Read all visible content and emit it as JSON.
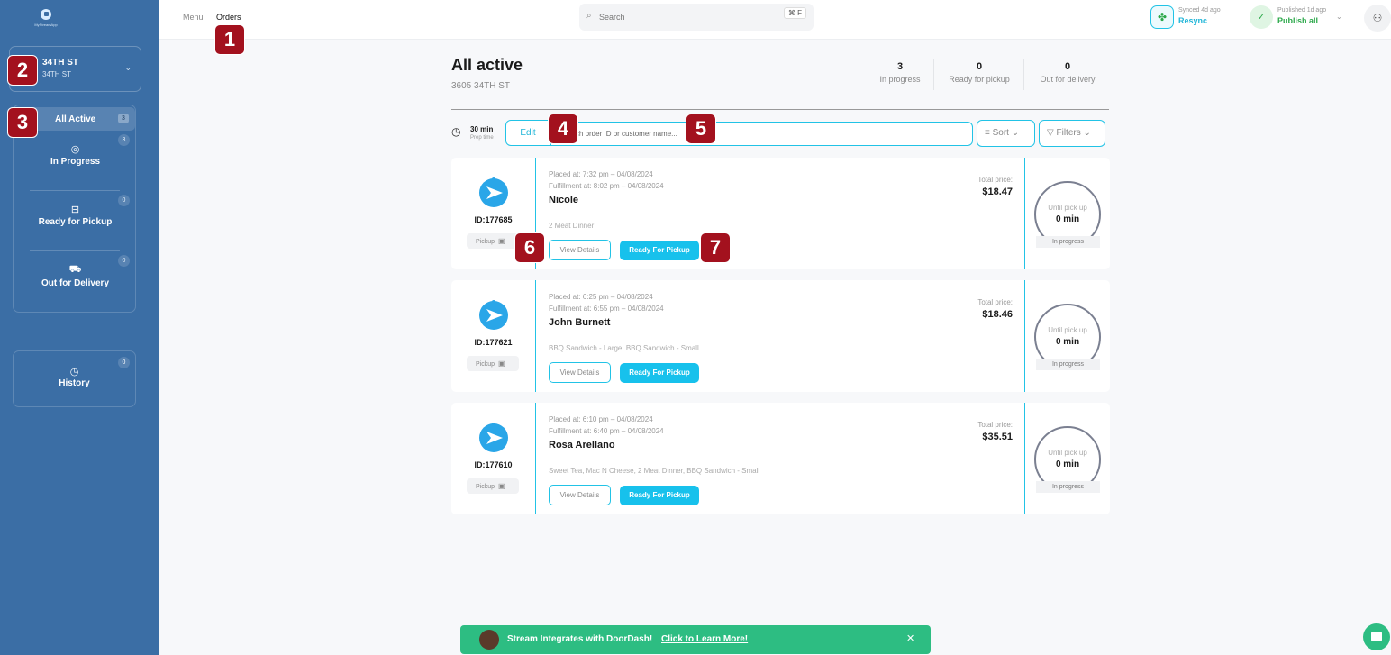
{
  "sidebar": {
    "logo_text": "MyStreamApp",
    "location": {
      "name": "34TH ST",
      "sub": "34TH ST"
    },
    "nav": [
      {
        "label": "All Active",
        "count": "3"
      },
      {
        "label": "In Progress",
        "count": "3",
        "icon": "pot-icon"
      },
      {
        "label": "Ready for Pickup",
        "count": "0",
        "icon": "bag-icon"
      },
      {
        "label": "Out for Delivery",
        "count": "0",
        "icon": "truck-icon"
      }
    ],
    "history": {
      "label": "History",
      "count": "0",
      "icon": "clock-icon"
    }
  },
  "header": {
    "tabs": [
      "Menu",
      "Orders"
    ],
    "search_placeholder": "Search",
    "search_shortcut": "⌘ F",
    "sync": {
      "status": "Synced 4d ago",
      "action": "Resync"
    },
    "publish": {
      "status": "Published 1d ago",
      "action": "Publish all"
    }
  },
  "main": {
    "title": "All active",
    "address": "3605 34TH ST",
    "stats": [
      {
        "value": "3",
        "label": "In progress"
      },
      {
        "value": "0",
        "label": "Ready for pickup"
      },
      {
        "value": "0",
        "label": "Out for delivery"
      }
    ],
    "prep": {
      "value": "30 min",
      "label": "Prep time"
    },
    "edit_label": "Edit",
    "order_search_placeholder": "Search order ID or customer name...",
    "sort_label": "Sort",
    "filters_label": "Filters"
  },
  "orders": [
    {
      "id": "ID:177685",
      "type": "Pickup",
      "placed": "Placed at: 7:32 pm – 04/08/2024",
      "fulfillment": "Fulfillment at: 8:02 pm – 04/08/2024",
      "customer": "Nicole",
      "items": "2 Meat Dinner",
      "details_label": "View Details",
      "ready_label": "Ready For Pickup",
      "total_label": "Total price:",
      "total": "$18.47",
      "timer_label": "Until pick up",
      "timer_value": "0 min",
      "status": "In progress"
    },
    {
      "id": "ID:177621",
      "type": "Pickup",
      "placed": "Placed at: 6:25 pm – 04/08/2024",
      "fulfillment": "Fulfillment at: 6:55 pm – 04/08/2024",
      "customer": "John Burnett",
      "items": "BBQ Sandwich - Large, BBQ Sandwich - Small",
      "details_label": "View Details",
      "ready_label": "Ready For Pickup",
      "total_label": "Total price:",
      "total": "$18.46",
      "timer_label": "Until pick up",
      "timer_value": "0 min",
      "status": "In progress"
    },
    {
      "id": "ID:177610",
      "type": "Pickup",
      "placed": "Placed at: 6:10 pm – 04/08/2024",
      "fulfillment": "Fulfillment at: 6:40 pm – 04/08/2024",
      "customer": "Rosa Arellano",
      "items": "Sweet Tea, Mac N Cheese, 2 Meat Dinner, BBQ Sandwich - Small",
      "details_label": "View Details",
      "ready_label": "Ready For Pickup",
      "total_label": "Total price:",
      "total": "$35.51",
      "timer_label": "Until pick up",
      "timer_value": "0 min",
      "status": "In progress"
    }
  ],
  "banner": {
    "message": "Stream Integrates with DoorDash!",
    "link": "Click to Learn More!"
  },
  "annotations": [
    "1",
    "2",
    "3",
    "4",
    "5",
    "6",
    "7"
  ],
  "colors": {
    "sidebar": "#3b6ea5",
    "accent": "#22c3e6",
    "annotation": "#a3111e",
    "banner": "#2dbd82"
  }
}
